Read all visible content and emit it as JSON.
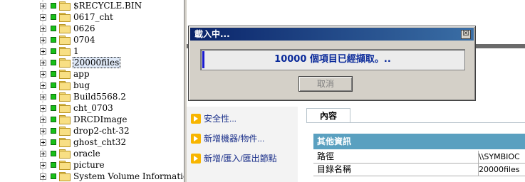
{
  "tree": {
    "items": [
      {
        "label": "$RECYCLE.BIN"
      },
      {
        "label": "0617_cht"
      },
      {
        "label": "0626"
      },
      {
        "label": "0704"
      },
      {
        "label": "1"
      },
      {
        "label": "20000files",
        "selected": true
      },
      {
        "label": "app"
      },
      {
        "label": "bug"
      },
      {
        "label": "Build5568.2"
      },
      {
        "label": "cht_0703"
      },
      {
        "label": "DRCDImage"
      },
      {
        "label": "drop2-cht-32"
      },
      {
        "label": "ghost_cht32"
      },
      {
        "label": "oracle"
      },
      {
        "label": "picture"
      },
      {
        "label": "System Volume Information"
      }
    ]
  },
  "actions": {
    "security": "安全性...",
    "add_device": "新增機器/物件...",
    "add_import_export": "新增/匯入/匯出節點"
  },
  "content_tab": {
    "label": "內容"
  },
  "info": {
    "header": "其他資訊",
    "rows": [
      {
        "key": "路徑",
        "value": "\\\\SYMBIOC"
      },
      {
        "key": "目錄名稱",
        "value": "20000files"
      }
    ]
  },
  "dialog": {
    "title": "載入中...",
    "close_symbol": "☒",
    "progress_text": "10000 個項目已經擷取。..",
    "cancel_label": "取消"
  }
}
